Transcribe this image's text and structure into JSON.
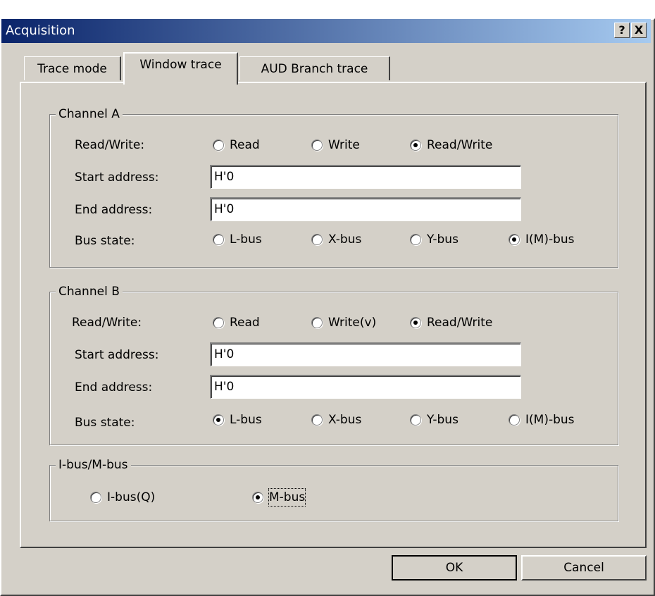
{
  "window": {
    "title": "Acquisition",
    "help_label": "?",
    "close_label": "X"
  },
  "tabs": [
    "Trace mode",
    "Window trace",
    "AUD Branch trace"
  ],
  "channel_a": {
    "title": "Channel A",
    "rw_label": "Read/Write:",
    "rw_options": [
      "Read",
      "Write",
      "Read/Write"
    ],
    "start_label": "Start address:",
    "start_value": "H'0",
    "end_label": "End address:",
    "end_value": "H'0",
    "bus_label": "Bus state:",
    "bus_options": [
      "L-bus",
      "X-bus",
      "Y-bus",
      "I(M)-bus"
    ]
  },
  "channel_b": {
    "title": "Channel B",
    "rw_label": "Read/Write:",
    "rw_options": [
      "Read",
      "Write(v)",
      "Read/Write"
    ],
    "start_label": "Start address:",
    "start_value": "H'0",
    "end_label": "End address:",
    "end_value": "H'0",
    "bus_label": "Bus state:",
    "bus_options": [
      "L-bus",
      "X-bus",
      "Y-bus",
      "I(M)-bus"
    ]
  },
  "ibus_mbus": {
    "title": "I-bus/M-bus",
    "options": [
      "I-bus(Q)",
      "M-bus"
    ]
  },
  "buttons": {
    "ok": "OK",
    "cancel": "Cancel"
  }
}
